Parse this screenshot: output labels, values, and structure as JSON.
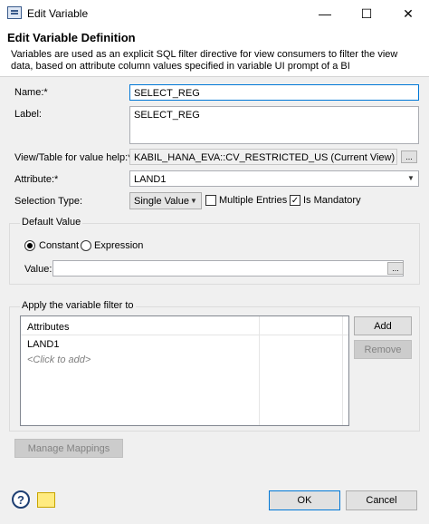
{
  "window": {
    "title": "Edit Variable",
    "minimize": "—",
    "maximize": "☐",
    "close": "✕"
  },
  "header": {
    "title": "Edit Variable Definition",
    "description": "Variables are used as an explicit SQL filter directive for view consumers to filter the view data, based on attribute column values specified in variable UI prompt of a BI"
  },
  "form": {
    "name_label": "Name:*",
    "name_value": "SELECT_REG",
    "label_label": "Label:",
    "label_value": "SELECT_REG",
    "view_label": "View/Table for value help:*",
    "view_value": "KABIL_HANA_EVA::CV_RESTRICTED_US (Current View)",
    "attribute_label": "Attribute:*",
    "attribute_value": "LAND1",
    "selection_label": "Selection Type:",
    "selection_value": "Single Value",
    "multiple_entries_label": "Multiple Entries",
    "multiple_entries_checked": false,
    "is_mandatory_label": "Is Mandatory",
    "is_mandatory_checked": true,
    "browse_label": "..."
  },
  "default_value": {
    "group_title": "Default Value",
    "constant_label": "Constant",
    "expression_label": "Expression",
    "selected": "constant",
    "value_label": "Value:",
    "value": "",
    "browse_label": "..."
  },
  "filter": {
    "group_title": "Apply the variable filter to",
    "column_header": "Attributes",
    "rows": [
      "LAND1"
    ],
    "add_placeholder": "<Click to add>",
    "add_button": "Add",
    "remove_button": "Remove"
  },
  "footer": {
    "manage_mappings": "Manage Mappings",
    "ok": "OK",
    "cancel": "Cancel"
  },
  "colors": {
    "focus_border": "#0078d7",
    "disabled_text": "#838383",
    "accent_help": "#1e3f73"
  }
}
